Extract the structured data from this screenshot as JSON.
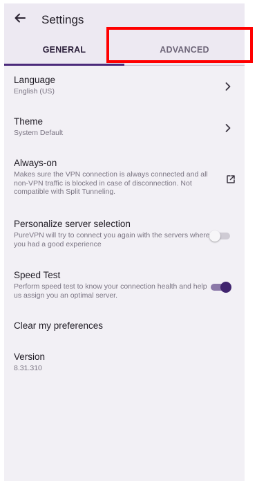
{
  "app_bar": {
    "back_icon": "arrow-left-icon",
    "title": "Settings"
  },
  "tabs": [
    {
      "label": "GENERAL",
      "selected": true
    },
    {
      "label": "ADVANCED",
      "selected": false
    }
  ],
  "settings": {
    "language": {
      "title": "Language",
      "value": "English (US)",
      "icon": "chevron-right-icon"
    },
    "theme": {
      "title": "Theme",
      "value": "System Default",
      "icon": "chevron-right-icon"
    },
    "always_on": {
      "title": "Always-on",
      "description": "Makes sure the VPN connection is always connected and all non-VPN traffic is blocked in case of disconnection. Not compatible with Split Tunneling.",
      "icon": "open-external-icon"
    },
    "personalize": {
      "title": "Personalize server selection",
      "description": "PureVPN will try to connect you again with the servers where you had a good experience",
      "enabled": false
    },
    "speed_test": {
      "title": "Speed Test",
      "description": "Perform speed test to know your connection health and help us assign you an optimal server.",
      "enabled": true
    },
    "clear_prefs": {
      "title": "Clear my preferences"
    },
    "version": {
      "title": "Version",
      "value": "8.31.310"
    }
  },
  "colors": {
    "accent": "#4b2a7b",
    "toggle_on_thumb": "#40246e",
    "toggle_on_track": "#8b78a8",
    "highlight": "#ff0000",
    "background": "#f2f0f5"
  }
}
